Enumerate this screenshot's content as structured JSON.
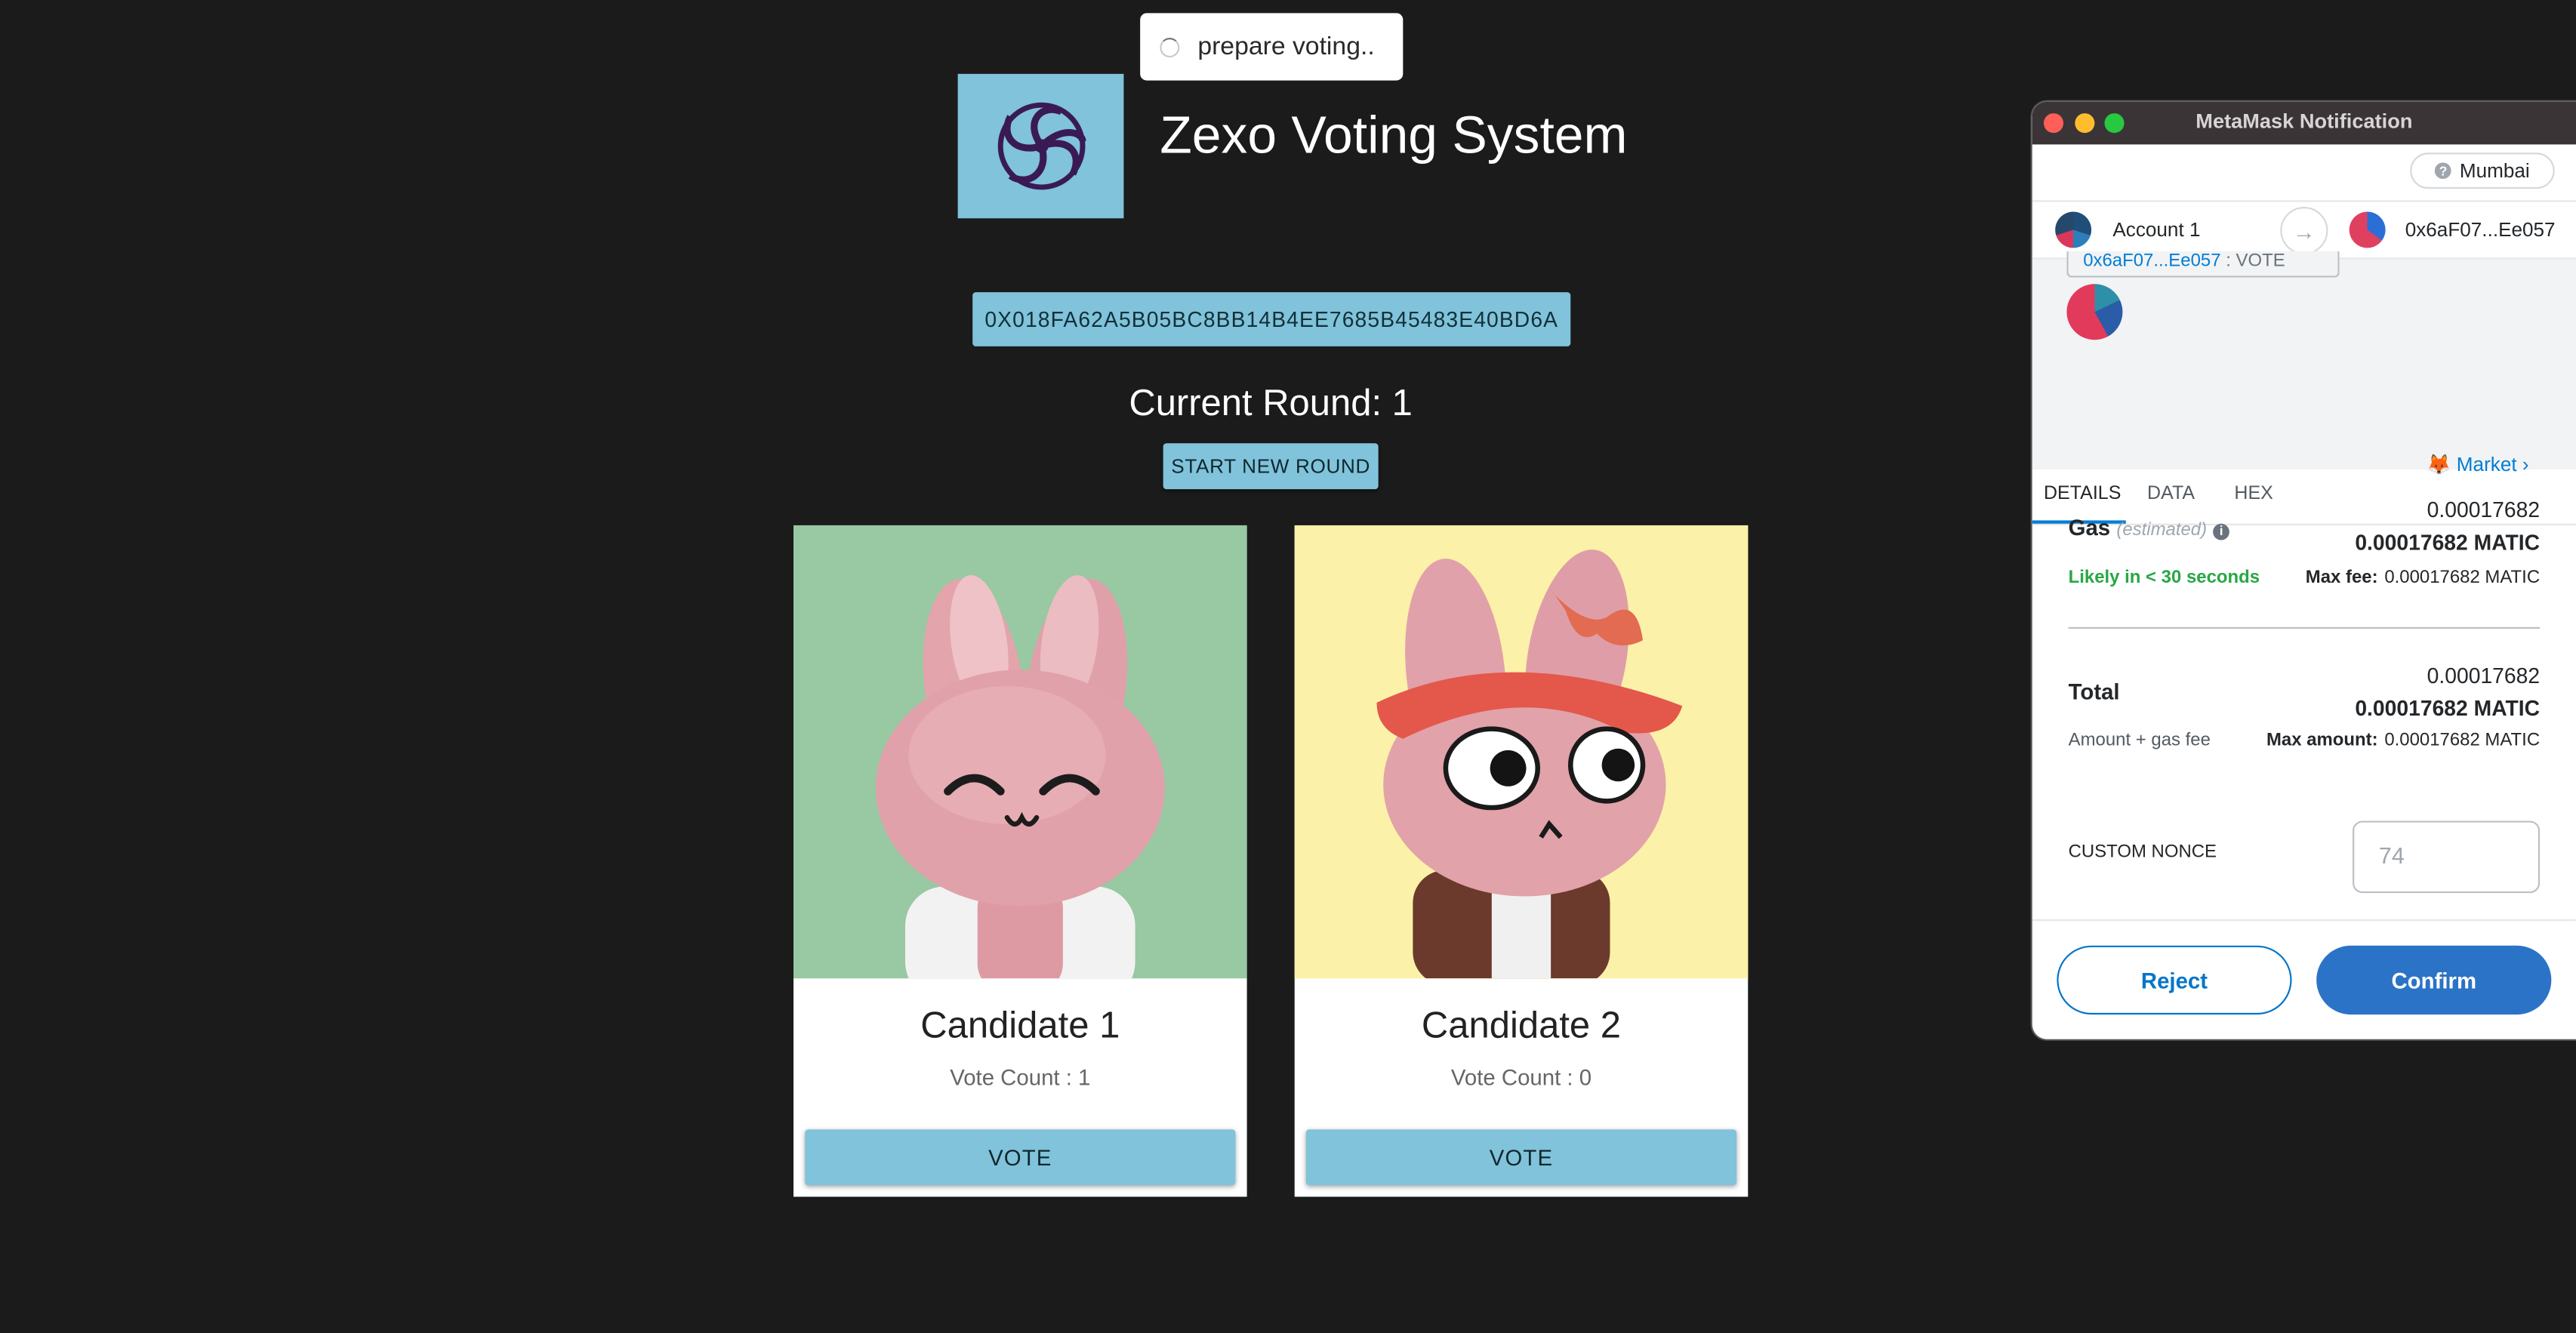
{
  "toast": {
    "text": "prepare voting.."
  },
  "header": {
    "title": "Zexo Voting System"
  },
  "contract_address": "0X018FA62A5B05BC8BB14B4EE7685B45483E40BD6A",
  "round": {
    "label": "Current Round: 1",
    "start_button": "START NEW ROUND"
  },
  "candidates": [
    {
      "name": "Candidate 1",
      "vote_count": "Vote Count : 1",
      "vote_button": "VOTE",
      "bg": "#98c9a2"
    },
    {
      "name": "Candidate 2",
      "vote_count": "Vote Count : 0",
      "vote_button": "VOTE",
      "bg": "#fcf1a8"
    }
  ],
  "metamask": {
    "window_title": "MetaMask Notification",
    "network": "Mumbai",
    "from_account": "Account 1",
    "to_address": "0x6aF07...Ee057",
    "method_address": "0x6aF07...Ee057",
    "method": ": VOTE",
    "tabs": [
      "DETAILS",
      "DATA",
      "HEX"
    ],
    "market_label": "Market",
    "gas": {
      "label": "Gas",
      "estimated": "(estimated)",
      "value": "0.00017682",
      "value_matic": "0.00017682 MATIC",
      "likely": "Likely in < 30 seconds",
      "max_fee_label": "Max fee:",
      "max_fee_value": "0.00017682 MATIC"
    },
    "total": {
      "label": "Total",
      "value": "0.00017682",
      "value_matic": "0.00017682 MATIC",
      "sub_label": "Amount + gas fee",
      "max_amount_label": "Max amount:",
      "max_amount_value": "0.00017682 MATIC"
    },
    "custom_nonce_label": "CUSTOM NONCE",
    "custom_nonce_placeholder": "74",
    "reject_label": "Reject",
    "confirm_label": "Confirm",
    "colors": {
      "accent_blue": "#037dd6",
      "confirm_bg": "#2b73c6",
      "likely_green": "#28a745"
    }
  }
}
